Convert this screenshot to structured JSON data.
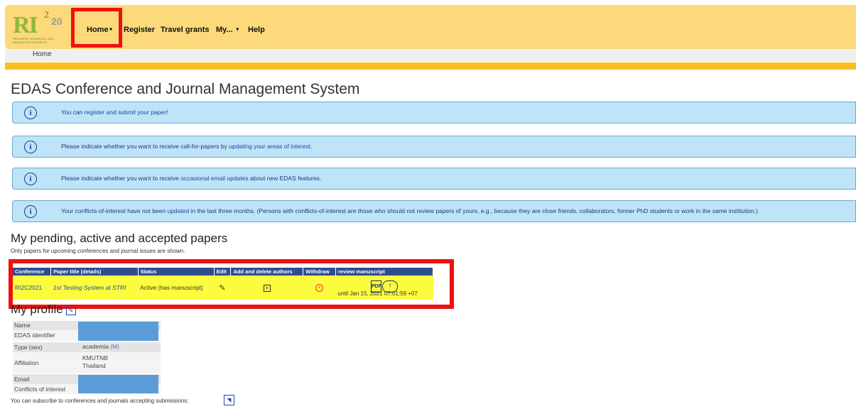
{
  "header": {
    "logo_text": "RI",
    "logo_superscript": "2",
    "logo_year": "20",
    "logo_tagline": "RESEARCH, INVENTION, AND INNOVATION CONGRESS",
    "nav": [
      {
        "label": "Home",
        "caret": "▼"
      },
      {
        "label": "Register"
      },
      {
        "label": "Travel grants"
      },
      {
        "label": "My...",
        "caret": "▼"
      },
      {
        "label": "Help"
      }
    ]
  },
  "breadcrumb": "Home",
  "page_title": "EDAS Conference and Journal Management System",
  "messages": [
    {
      "parts": [
        "You can ",
        "register and submit your paper",
        "!"
      ]
    },
    {
      "parts": [
        "Please indicate whether you want to receive call-for-papers by ",
        "updating your areas of interest",
        "."
      ]
    },
    {
      "parts": [
        "Please indicate whether you want to receive ",
        "occasional email updates",
        " about new EDAS features."
      ]
    },
    {
      "parts": [
        "Your conflicts-of-interest have not been ",
        "updated",
        " in the last three months. (Persons with conflicts-of-interest are those who should not review papers of yours, e.g., because they are close friends, collaborators, former PhD students or work in the same institution.)"
      ]
    }
  ],
  "info_icon": "info-icon",
  "papers": {
    "heading": "My pending, active and accepted papers",
    "note": "Only papers for upcoming conferences and journal issues are shown.",
    "columns": [
      "Conference",
      "Paper title (details)",
      "Status",
      "Edit",
      "Add and delete authors",
      "Withdraw",
      "review manuscript"
    ],
    "rows": [
      {
        "conference": "RI2C2021",
        "title": "1st Testing System at STRI",
        "status": "Active (has manuscript)",
        "review_until": "until Jan 15, 2021 07:01:59 +07"
      }
    ]
  },
  "profile": {
    "heading": "My profile",
    "rows": [
      {
        "label": "Name",
        "value": ""
      },
      {
        "label": "EDAS identifier",
        "value": ""
      },
      {
        "label": "Type (sex)",
        "value": "academia",
        "extra": "(M)"
      },
      {
        "label": "Affiliation",
        "value": "KMUTNB",
        "value2": "Thailand"
      },
      {
        "label": "Email",
        "value": ""
      },
      {
        "label": "Conflicts of interest",
        "value": ""
      }
    ]
  },
  "subscribe_text": "You can subscribe to conferences and journals accepting submissions:",
  "colors": {
    "header_bg": "#fcd97a",
    "gold_bar": "#f9bf27",
    "info_bg": "#bfe3f7",
    "table_header": "#2e4e8f",
    "row_highlight": "#fcfc3f",
    "annotation_red": "#ee1111",
    "redaction": "#5b9bd8"
  }
}
